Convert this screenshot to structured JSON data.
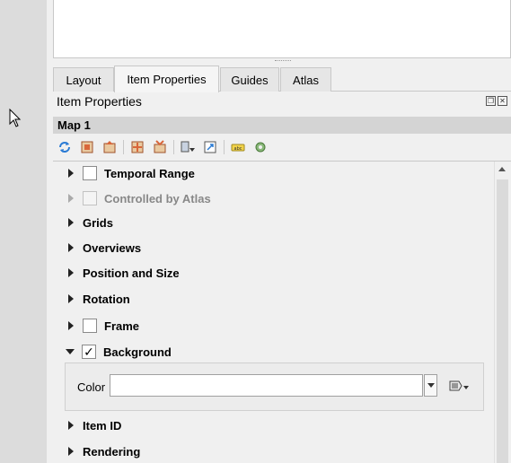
{
  "tabs": [
    {
      "label": "Layout",
      "active": false
    },
    {
      "label": "Item Properties",
      "active": true
    },
    {
      "label": "Guides",
      "active": false
    },
    {
      "label": "Atlas",
      "active": false
    }
  ],
  "dock": {
    "title": "Item Properties",
    "float_button": "float-icon",
    "close_button": "close-icon"
  },
  "item": {
    "title": "Map 1"
  },
  "toolbar_icons": [
    "refresh-icon",
    "set-extent-icon",
    "view-extent-icon",
    "move-content-icon",
    "set-scale-icon",
    "bookmark-icon",
    "zoom-layer-icon",
    "label-settings-icon",
    "clipping-icon"
  ],
  "sections": [
    {
      "label": "Temporal Range",
      "checkbox": true,
      "checked": false,
      "expanded": false,
      "enabled": true
    },
    {
      "label": "Controlled by Atlas",
      "checkbox": true,
      "checked": false,
      "expanded": false,
      "enabled": false
    },
    {
      "label": "Grids",
      "checkbox": false,
      "expanded": false,
      "enabled": true
    },
    {
      "label": "Overviews",
      "checkbox": false,
      "expanded": false,
      "enabled": true
    },
    {
      "label": "Position and Size",
      "checkbox": false,
      "expanded": false,
      "enabled": true
    },
    {
      "label": "Rotation",
      "checkbox": false,
      "expanded": false,
      "enabled": true
    },
    {
      "label": "Frame",
      "checkbox": true,
      "checked": false,
      "expanded": false,
      "enabled": true
    },
    {
      "label": "Background",
      "checkbox": true,
      "checked": true,
      "expanded": true,
      "enabled": true
    },
    {
      "label": "Item ID",
      "checkbox": false,
      "expanded": false,
      "enabled": true
    },
    {
      "label": "Rendering",
      "checkbox": false,
      "expanded": false,
      "enabled": true
    }
  ],
  "background": {
    "color_label": "Color",
    "color_value": "",
    "checkmark": "✓"
  }
}
